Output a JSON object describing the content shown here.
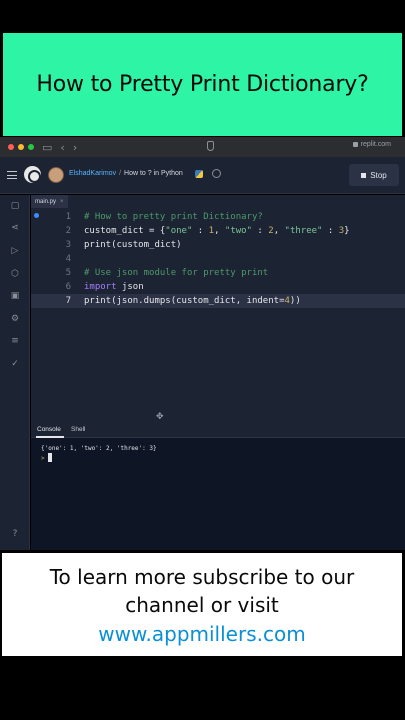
{
  "title_banner": "How to Pretty Print Dictionary?",
  "browser": {
    "url": "replit.com"
  },
  "header": {
    "user": "ElshadKarimov",
    "separator": "/",
    "repl_name": "How to ? in Python",
    "stop_label": "Stop"
  },
  "editor": {
    "tab_label": "main.py",
    "tab_close": "×",
    "lines": [
      {
        "n": "1",
        "parts": [
          {
            "t": "# How to pretty print Dictionary?",
            "k": "com"
          }
        ]
      },
      {
        "n": "2",
        "parts": [
          {
            "t": "custom_dict = {",
            "k": ""
          },
          {
            "t": "\"one\"",
            "k": "str"
          },
          {
            "t": " : ",
            "k": ""
          },
          {
            "t": "1",
            "k": "num"
          },
          {
            "t": ", ",
            "k": ""
          },
          {
            "t": "\"two\"",
            "k": "str"
          },
          {
            "t": " : ",
            "k": ""
          },
          {
            "t": "2",
            "k": "num"
          },
          {
            "t": ", ",
            "k": ""
          },
          {
            "t": "\"three\"",
            "k": "str"
          },
          {
            "t": " : ",
            "k": ""
          },
          {
            "t": "3",
            "k": "num"
          },
          {
            "t": "}",
            "k": ""
          }
        ]
      },
      {
        "n": "3",
        "parts": [
          {
            "t": "print(custom_dict)",
            "k": ""
          }
        ]
      },
      {
        "n": "4",
        "parts": []
      },
      {
        "n": "5",
        "parts": [
          {
            "t": "# Use json module for pretty print",
            "k": "com"
          }
        ]
      },
      {
        "n": "6",
        "parts": [
          {
            "t": "import",
            "k": "kw"
          },
          {
            "t": " json",
            "k": ""
          }
        ]
      },
      {
        "n": "7",
        "parts": [
          {
            "t": "print(json.dumps(custom_dict, indent=",
            "k": ""
          },
          {
            "t": "4",
            "k": "num"
          },
          {
            "t": "))",
            "k": ""
          }
        ]
      }
    ],
    "active_line": "7"
  },
  "console": {
    "tab_console": "Console",
    "tab_shell": "Shell",
    "output": "{'one': 1, 'two': 2, 'three': 3}",
    "prompt": ">"
  },
  "subscribe": {
    "line1": "To learn more subscribe to our",
    "line2": "channel or visit",
    "link": "www.appmillers.com"
  },
  "colors": {
    "title_bg": "#2ef4a6",
    "editor_bg": "#1c2333",
    "console_bg": "#0e1525",
    "link": "#0b8fd6"
  },
  "icons": {
    "sidebar": [
      "files-icon",
      "share-icon",
      "console-icon",
      "packages-icon",
      "secrets-icon",
      "settings-icon",
      "database-icon",
      "check-icon",
      "help-icon"
    ]
  }
}
